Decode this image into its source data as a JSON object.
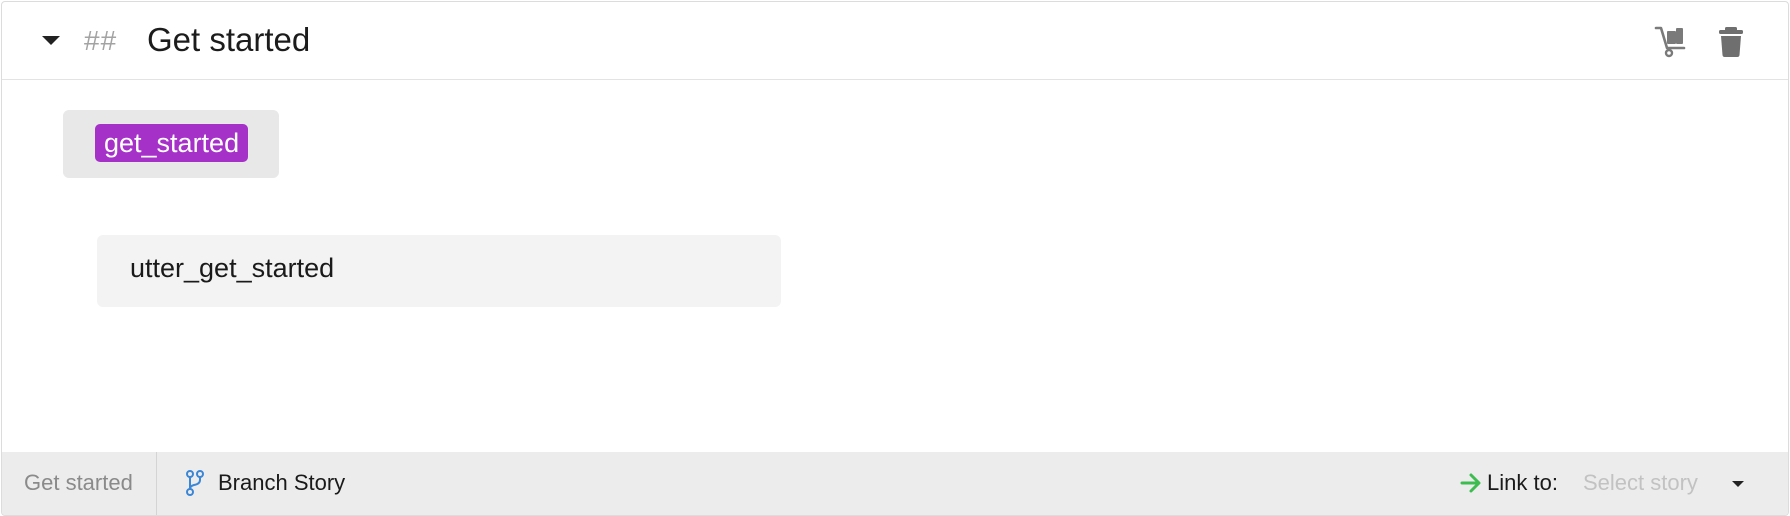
{
  "story": {
    "title": "Get started",
    "heading_marker": "##",
    "icons": {
      "collapse": "caret-down-icon",
      "move": "move-story-icon",
      "delete": "trash-icon"
    }
  },
  "steps": {
    "intent": "get_started",
    "response": "utter_get_started"
  },
  "footer": {
    "story_name": "Get started",
    "branch_label": "Branch Story",
    "link_label": "Link to:",
    "link_select_placeholder": "Select story"
  },
  "colors": {
    "intent_badge": "#a631c9",
    "branch_icon": "#3b86d6",
    "link_arrow": "#3dbd4f"
  }
}
